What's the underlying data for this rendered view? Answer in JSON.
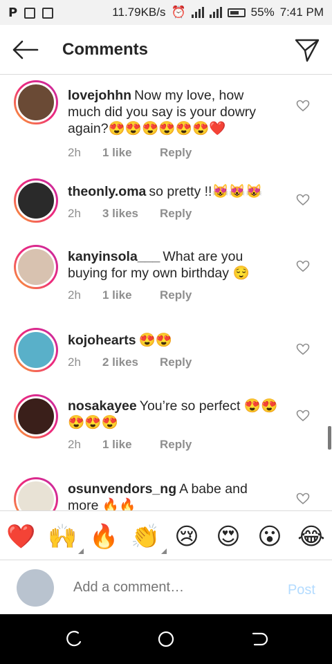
{
  "status_bar": {
    "net_speed": "11.79KB/s",
    "battery_pct": "55%",
    "time": "7:41 PM",
    "left_icons": [
      "p-icon",
      "image-icon",
      "save-icon"
    ]
  },
  "header": {
    "title": "Comments",
    "back_icon": "arrow-left-icon",
    "send_icon": "paper-plane-icon"
  },
  "comments": [
    {
      "user": "lovejohhn",
      "text": "Now my love, how much did you say is your dowry again?😍😍😍😍😍😍❤️",
      "time": "2h",
      "likes": "1 like",
      "reply": "Reply",
      "avatar_color": "#6a4a35"
    },
    {
      "user": "theonly.oma",
      "text": "so pretty !!😻😻😻",
      "time": "2h",
      "likes": "3 likes",
      "reply": "Reply",
      "avatar_color": "#2a2a2a"
    },
    {
      "user": "kanyinsola___",
      "text": "What are you buying for my own birthday 😌",
      "time": "2h",
      "likes": "1 like",
      "reply": "Reply",
      "avatar_color": "#d8c2b0"
    },
    {
      "user": "kojohearts",
      "text": "😍😍",
      "time": "2h",
      "likes": "2 likes",
      "reply": "Reply",
      "avatar_color": "#59b0c9"
    },
    {
      "user": "nosakayee",
      "text": "You’re so perfect 😍😍😍😍😍",
      "time": "2h",
      "likes": "1 like",
      "reply": "Reply",
      "avatar_color": "#3a1f1a"
    },
    {
      "user": "osunvendors_ng",
      "text": "A babe and more 🔥🔥",
      "time": "",
      "likes": "",
      "reply": "",
      "avatar_color": "#e8e2d5"
    }
  ],
  "emoji_bar": [
    "❤️",
    "🙌",
    "🔥",
    "👏",
    "😢",
    "😍",
    "😮",
    "😂"
  ],
  "composer": {
    "placeholder": "Add a comment…",
    "post_label": "Post"
  },
  "colors": {
    "story_ring_start": "#f9a52f",
    "story_ring_end": "#c32aa3",
    "post_disabled": "#b3dbff",
    "meta_gray": "#8e8e8e"
  }
}
